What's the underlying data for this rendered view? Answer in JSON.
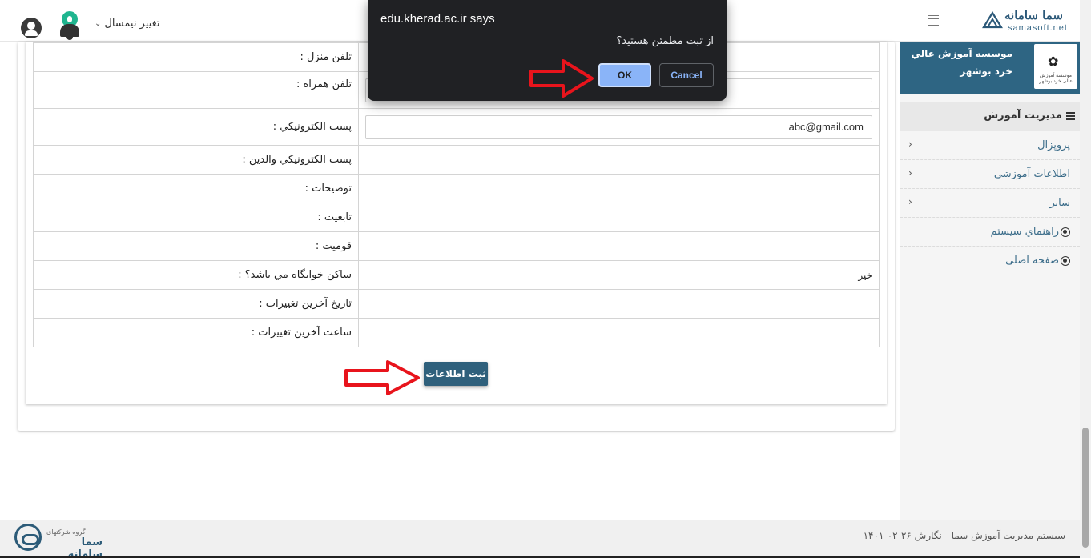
{
  "topbar": {
    "semester_label": "تغيير نيمسال",
    "brand_name": "سما سامانه",
    "brand_url": "samasoft.net"
  },
  "sidebar": {
    "org_name": "موسسه آموزش عالي خرد بوشهر",
    "org_logo_text": "موسسه آموزش عالی خرد بوشهر",
    "menu_title": "مديريت آموزش",
    "items": [
      {
        "label": "پروپزال"
      },
      {
        "label": "اطلاعات آموزشي"
      },
      {
        "label": "ساير"
      },
      {
        "label": "راهنماي سيستم"
      },
      {
        "label": "صفحه اصلی"
      }
    ]
  },
  "form": {
    "rows": [
      {
        "label": "تلفن منزل :",
        "value": ""
      },
      {
        "label": "تلفن همراه :",
        "value": ""
      },
      {
        "label": "پست الكترونيكي :",
        "value": "abc@gmail.com"
      },
      {
        "label": "پست الكترونيكي والدين :",
        "value": ""
      },
      {
        "label": "توضيحات :",
        "value": ""
      },
      {
        "label": "تابعيت :",
        "value": ""
      },
      {
        "label": "قوميت :",
        "value": ""
      },
      {
        "label": "ساكن خوابگاه مي باشد؟ :",
        "value": "خير"
      },
      {
        "label": "تاريخ آخرين تغييرات :",
        "value": ""
      },
      {
        "label": "ساعت آخرين تغييرات :",
        "value": ""
      }
    ],
    "submit_label": "ثبت اطلاعات"
  },
  "dialog": {
    "title": "edu.kherad.ac.ir says",
    "message": "از ثبت مطمئن هستيد؟",
    "ok_label": "OK",
    "cancel_label": "Cancel"
  },
  "footer": {
    "text": "سيستم مديريت آموزش سما - نگارش ۲۶-۰۲-۱۴۰۱",
    "logo_small": "گروه شرکتهای",
    "logo_name": "سما سامانه"
  },
  "colors": {
    "accent": "#2f607c",
    "sidebar_header": "#2e6583",
    "dialog_bg": "#202124",
    "dialog_button": "#8ab4f8",
    "annotation_arrow": "#e8141c"
  }
}
